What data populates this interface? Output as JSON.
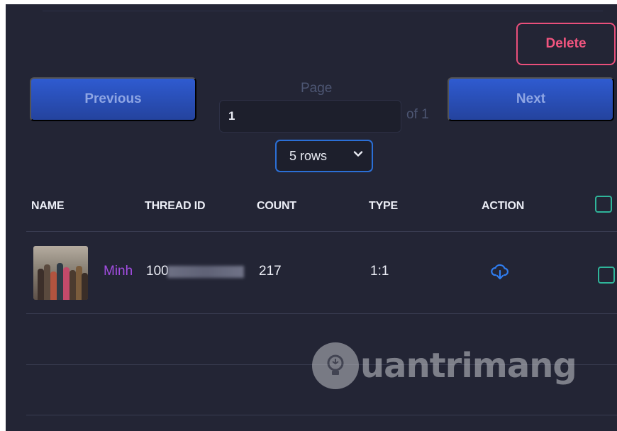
{
  "actions": {
    "delete_label": "Delete"
  },
  "pagination": {
    "previous_label": "Previous",
    "next_label": "Next",
    "page_label": "Page",
    "page_value": "1",
    "of_text": "of 1",
    "rows_selected": "5 rows"
  },
  "table": {
    "headers": [
      "NAME",
      "THREAD ID",
      "COUNT",
      "TYPE",
      "ACTION"
    ],
    "rows": [
      {
        "name": "Minh",
        "thread_id": "100",
        "count": "217",
        "type": "1:1",
        "action_icon": "cloud-download-icon"
      }
    ]
  },
  "watermark": {
    "text": "uantrimang"
  },
  "colors": {
    "background": "#232535",
    "accent_blue": "#2f5bd0",
    "delete_pink": "#f2557f",
    "checkbox_green": "#2fb59a",
    "name_purple": "#a14de0"
  }
}
